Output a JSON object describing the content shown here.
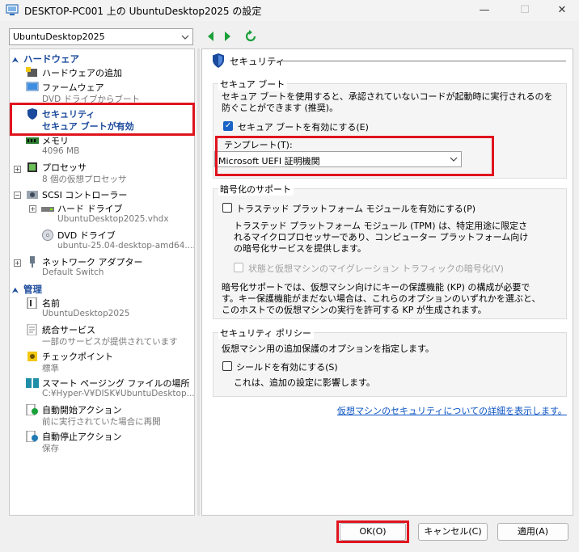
{
  "window": {
    "title": "DESKTOP-PC001 上の UbuntuDesktop2025 の設定",
    "minimize_glyph": "—",
    "maximize_glyph": "☐",
    "close_glyph": "✕"
  },
  "vm_selector": {
    "selected": "UbuntuDesktop2025"
  },
  "left_panel": {
    "hardware_header": "ハードウェア",
    "hardware_items": [
      {
        "label": "ハードウェアの追加",
        "sub": "",
        "icon": "add-hardware-icon"
      },
      {
        "label": "ファームウェア",
        "sub": "DVD ドライブからブート",
        "icon": "firmware-icon"
      },
      {
        "label": "セキュリティ",
        "sub": "セキュア ブートが有効",
        "icon": "shield-icon"
      },
      {
        "label": "メモリ",
        "sub": "4096 MB",
        "icon": "memory-icon"
      },
      {
        "label": "プロセッサ",
        "sub": "8 個の仮想プロセッサ",
        "icon": "processor-icon"
      },
      {
        "label": "SCSI コントローラー",
        "sub": "",
        "icon": "scsi-controller-icon"
      },
      {
        "label": "ハード ドライブ",
        "sub": "UbuntuDesktop2025.vhdx",
        "icon": "hard-drive-icon"
      },
      {
        "label": "DVD ドライブ",
        "sub": "ubuntu-25.04-desktop-amd64....",
        "icon": "dvd-drive-icon"
      },
      {
        "label": "ネットワーク アダプター",
        "sub": "Default Switch",
        "icon": "network-adapter-icon"
      }
    ],
    "management_header": "管理",
    "management_items": [
      {
        "label": "名前",
        "sub": "UbuntuDesktop2025",
        "icon": "name-icon"
      },
      {
        "label": "統合サービス",
        "sub": "一部のサービスが提供されています",
        "icon": "integration-services-icon"
      },
      {
        "label": "チェックポイント",
        "sub": "標準",
        "icon": "checkpoint-icon"
      },
      {
        "label": "スマート ページング ファイルの場所",
        "sub": "C:¥Hyper-V¥DISK¥UbuntuDesktop...",
        "icon": "smart-paging-icon"
      },
      {
        "label": "自動開始アクション",
        "sub": "前に実行されていた場合に再開",
        "icon": "auto-start-icon"
      },
      {
        "label": "自動停止アクション",
        "sub": "保存",
        "icon": "auto-stop-icon"
      }
    ]
  },
  "security": {
    "title": "セキュリティ",
    "secure_boot": {
      "group_title": "セキュア ブート",
      "description": "セキュア ブートを使用すると、承認されていないコードが起動時に実行されるのを防ぐことができます (推奨)。",
      "enable_label": "セキュア ブートを有効にする(E)",
      "enable_checked": true,
      "template_label": "テンプレート(T):",
      "template_value": "Microsoft UEFI 証明機関"
    },
    "encryption": {
      "group_title": "暗号化のサポート",
      "tpm_label": "トラステッド プラットフォーム モジュールを有効にする(P)",
      "tpm_checked": false,
      "tpm_description": "トラステッド プラットフォーム モジュール (TPM) は、特定用途に限定されるマイクロプロセッサーであり、コンピューター プラットフォーム向けの暗号化サービスを提供します。",
      "migration_label": "状態と仮想マシンのマイグレーション トラフィックの暗号化(V)",
      "migration_checked": false,
      "kp_description": "暗号化サポートでは、仮想マシン向けにキーの保護機能 (KP) の構成が必要です。キー保護機能がまだない場合は、これらのオプションのいずれかを選ぶと、このホストでの仮想マシンの実行を許可する KP が生成されます。"
    },
    "policy": {
      "group_title": "セキュリティ ポリシー",
      "description": "仮想マシン用の追加保護のオプションを指定します。",
      "shield_label": "シールドを有効にする(S)",
      "shield_checked": false,
      "shield_note": "これは、追加の設定に影響します。"
    },
    "details_link": "仮想マシンのセキュリティについての詳細を表示します。"
  },
  "buttons": {
    "ok": "OK(O)",
    "cancel": "キャンセル(C)",
    "apply": "適用(A)"
  },
  "colors": {
    "accent": "#1a63c6",
    "highlight_outline": "#e0141e",
    "header_text": "#1a4a9c",
    "link": "#0a53c2"
  }
}
